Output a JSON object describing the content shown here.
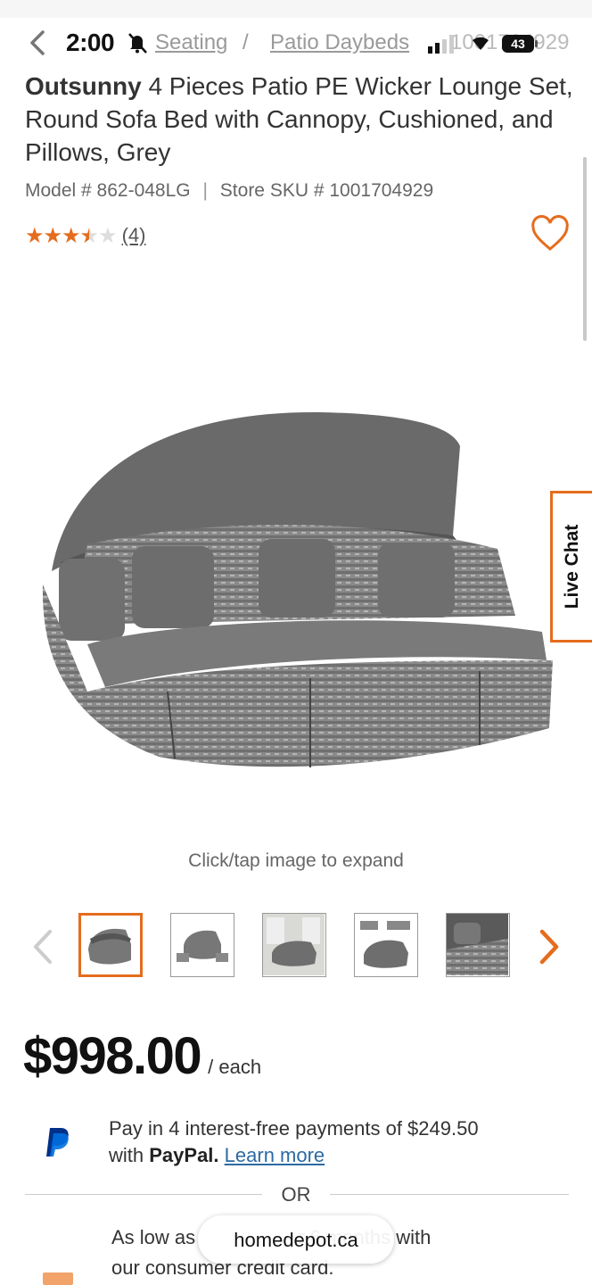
{
  "status_bar": {
    "time": "2:00",
    "battery": "43"
  },
  "breadcrumb": {
    "item1": "Seating",
    "item2": "Patio Daybeds",
    "sep": "/",
    "sku_ghost": "1001704929"
  },
  "product": {
    "brand": "Outsunny",
    "name": "4 Pieces Patio PE Wicker Lounge Set, Round Sofa Bed with Cannopy, Cushioned, and Pillows, Grey",
    "model": "Model # 862-048LG",
    "sku": "Store SKU # 1001704929",
    "model_sep": "|",
    "rating": 3.5,
    "review_count": "(4)"
  },
  "live_chat": "Live Chat",
  "image_hint": "Click/tap image to expand",
  "thumbnails": [
    "thumb-1",
    "thumb-2",
    "thumb-3",
    "thumb-4",
    "thumb-5"
  ],
  "price": {
    "amount": "$998.00",
    "unit": "/ each"
  },
  "paypal": {
    "line1": "Pay in 4 interest-free payments of $249.50",
    "line2_prefix": "with ",
    "brand": "PayPal.",
    "learn_more": "Learn more"
  },
  "or_label": "OR",
  "credit": {
    "line1_a": "As low as",
    "line1_b": "r 6 months with",
    "line2": "our consumer credit card."
  },
  "url_pill": "homedepot.ca",
  "colors": {
    "accent": "#e56c1d",
    "link": "#2c6aa3",
    "paypal_blue": "#003087"
  }
}
